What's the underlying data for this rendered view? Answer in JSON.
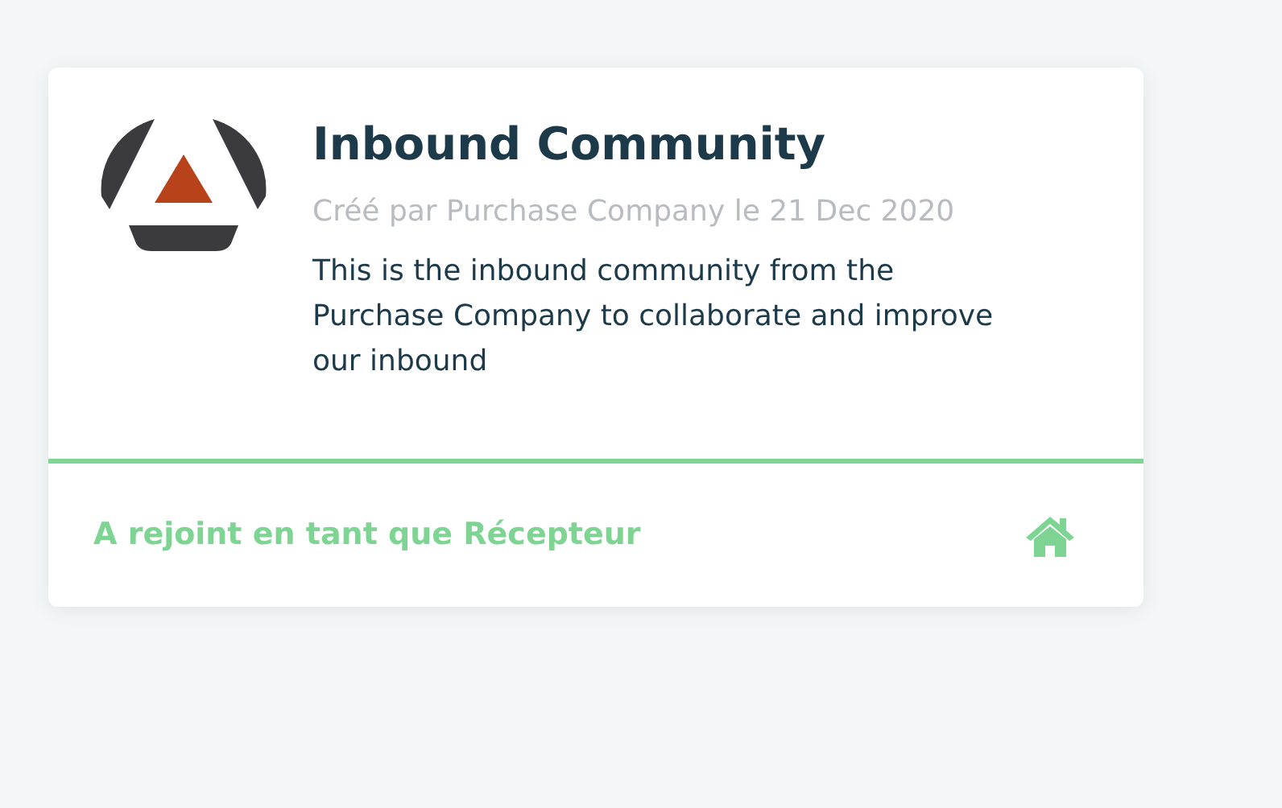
{
  "card": {
    "title": "Inbound Community",
    "subtitle": "Créé par Purchase Company le 21 Dec 2020",
    "description": "This is the inbound community from the Purchase Company to collaborate and improve our inbound",
    "footer": {
      "status": "A rejoint en tant que Récepteur"
    }
  }
}
